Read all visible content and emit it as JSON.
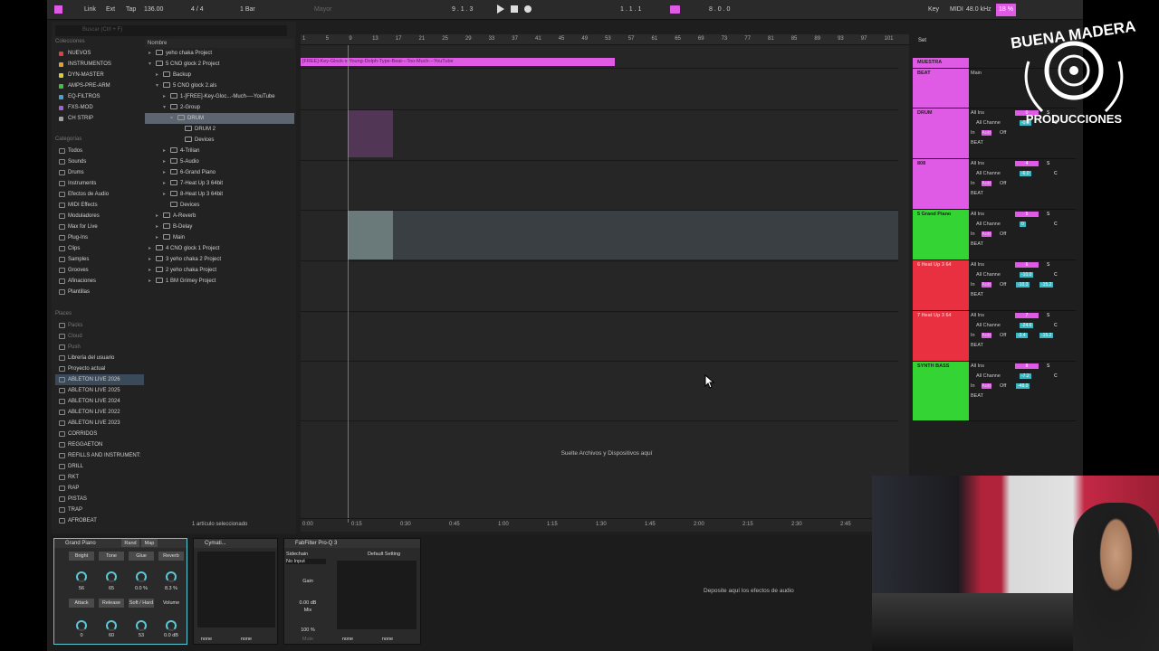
{
  "topbar": {
    "link": "Link",
    "ext": "Ext",
    "tap": "Tap",
    "tempo": "136.00",
    "signature": "4 / 4",
    "quantize": "1 Bar",
    "key_mode": "Mayor",
    "position": "9 .   1 .   3",
    "loop_start": "1 .   1 .   1",
    "loop_length": "8 .   0 .   0",
    "key_label": "Key",
    "midi_label": "MIDI",
    "sample_rate": "48.0 kHz",
    "cpu": "18 %"
  },
  "browser": {
    "search_placeholder": "Buscar (Ctrl + F)",
    "collections_header": "Colecciones",
    "collections": [
      {
        "label": "NUEVOS",
        "color": "#e04040"
      },
      {
        "label": "INSTRUMENTOS",
        "color": "#e0a030"
      },
      {
        "label": "DYN-MASTER",
        "color": "#d0d030"
      },
      {
        "label": "AMPS-PRE-ARM",
        "color": "#40c040"
      },
      {
        "label": "EQ-FILTROS",
        "color": "#40a0e0"
      },
      {
        "label": "FXS-MOD",
        "color": "#a060e0"
      },
      {
        "label": "CH STRIP",
        "color": "#a0a0a0"
      }
    ],
    "categories_header": "Categorías",
    "categories": [
      "Todos",
      "Sounds",
      "Drums",
      "Instruments",
      "Efectos de Audio",
      "MIDI Effects",
      "Moduladores",
      "Max for Live",
      "Plug-Ins",
      "Clips",
      "Samples",
      "Grooves",
      "Afinaciones",
      "Plantillas"
    ],
    "places_header": "Places",
    "places": [
      "Packs",
      "Cloud",
      "Push",
      "Librería del usuario",
      "Proyecto actual",
      "ABLETON LIVE 2026",
      "ABLETON LIVE 2025",
      "ABLETON LIVE 2024",
      "ABLETON LIVE 2022",
      "ABLETON LIVE 2023",
      "CORRIDOS",
      "REGGAETON",
      "REFILLS AND INSTRUMENT:",
      "DRILL",
      "RKT",
      "RAP",
      "PISTAS",
      "TRAP",
      "AFROBEAT"
    ],
    "name_header": "Nombre",
    "tree": [
      {
        "label": "yeho chaka Project",
        "indent": 0,
        "tri": "▸"
      },
      {
        "label": "5 CNO glock 2 Project",
        "indent": 0,
        "tri": "▾"
      },
      {
        "label": "Backup",
        "indent": 1,
        "tri": "▸"
      },
      {
        "label": "5 CNO glock 2.als",
        "indent": 1,
        "tri": "▾"
      },
      {
        "label": "1-[FREE]-Key-Gloc...-Much----YouTube",
        "indent": 2,
        "tri": "▸"
      },
      {
        "label": "2-Group",
        "indent": 2,
        "tri": "▾"
      },
      {
        "label": "DRUM",
        "indent": 3,
        "tri": "▾"
      },
      {
        "label": "DRUM 2",
        "indent": 4,
        "tri": ""
      },
      {
        "label": "Devices",
        "indent": 4,
        "tri": ""
      },
      {
        "label": "4-Trilian",
        "indent": 2,
        "tri": "▸"
      },
      {
        "label": "5-Audio",
        "indent": 2,
        "tri": "▸"
      },
      {
        "label": "6-Grand Piano",
        "indent": 2,
        "tri": "▸"
      },
      {
        "label": "7-Heat Up 3 64bit",
        "indent": 2,
        "tri": "▸"
      },
      {
        "label": "8-Heat Up 3 64bit",
        "indent": 2,
        "tri": "▸"
      },
      {
        "label": "Devices",
        "indent": 2,
        "tri": ""
      },
      {
        "label": "A-Reverb",
        "indent": 1,
        "tri": "▸"
      },
      {
        "label": "B-Delay",
        "indent": 1,
        "tri": "▸"
      },
      {
        "label": "Main",
        "indent": 1,
        "tri": "▸"
      },
      {
        "label": "4 CNO glock 1 Project",
        "indent": 0,
        "tri": "▸"
      },
      {
        "label": "3 yeho chaka 2 Project",
        "indent": 0,
        "tri": "▸"
      },
      {
        "label": "2 yeho chaka Project",
        "indent": 0,
        "tri": "▸"
      },
      {
        "label": "1 BM Grimey Project",
        "indent": 0,
        "tri": "▸"
      }
    ],
    "status": "1 artículo seleccionado"
  },
  "arrangement": {
    "bars": [
      "1",
      "5",
      "9",
      "13",
      "17",
      "21",
      "25",
      "29",
      "33",
      "37",
      "41",
      "45",
      "49",
      "53",
      "57",
      "61",
      "65",
      "69",
      "73",
      "77",
      "81",
      "85",
      "89",
      "93",
      "97",
      "101"
    ],
    "times": [
      "0:00",
      "0:15",
      "0:30",
      "0:45",
      "1:00",
      "1:15",
      "1:30",
      "1:45",
      "2:00",
      "2:15",
      "2:30",
      "2:45"
    ],
    "top_clip": "[FREE]-Key-Glock-x-Young-Dolph-Type-Beat---Too-Much---YouTube",
    "drop_text": "Suelte Archivos y Dispositivos aquí"
  },
  "tracks": [
    {
      "name": "MUESTRA",
      "color": "#e05be5",
      "in": "",
      "sub": ""
    },
    {
      "name": "BEAT",
      "color": "#e05be5",
      "in": "Main",
      "sub": ""
    },
    {
      "name": "DRUM",
      "color": "#e05be5",
      "in": "All Ins",
      "sub": "All Channe",
      "out": "BEAT",
      "vol": "0",
      "pan": "-0.0"
    },
    {
      "name": "808",
      "color": "#e05be5",
      "in": "All Ins",
      "sub": "All Channe",
      "out": "BEAT",
      "vol": "4",
      "pan": "-6.0"
    },
    {
      "name": "5 Grand Piano",
      "color": "#35d435",
      "in": "All Ins",
      "sub": "All Channe",
      "out": "BEAT",
      "vol": "5",
      "pan": "0"
    },
    {
      "name": "6 Heat Up 3 64",
      "color": "#e83040",
      "in": "All Ins",
      "sub": "All Channe",
      "out": "BEAT",
      "vol": "6",
      "pan": "-10.0",
      "extra": "-10.3",
      "extra2": "-15.2"
    },
    {
      "name": "7 Heat Up 3 64",
      "color": "#e83040",
      "in": "All Ins",
      "sub": "All Channe",
      "out": "BEAT",
      "vol": "7",
      "pan": "-24.6",
      "extra": "-3.4",
      "extra2": "-15.2"
    },
    {
      "name": "SYNTH BASS",
      "color": "#35d435",
      "in": "All Ins",
      "sub": "All Channe",
      "out": "BEAT",
      "vol": "8",
      "pan": "-7.2",
      "extra": "-48.0"
    }
  ],
  "track_labels": {
    "in": "In",
    "auto": "Auto",
    "off": "Off",
    "set": "Set",
    "s": "S",
    "c": "C"
  },
  "devices": {
    "grand_piano": {
      "title": "Grand Piano",
      "rand": "Rand",
      "map": "Map",
      "params1": [
        "Bright",
        "Tone",
        "Glue",
        "Reverb"
      ],
      "values1": [
        "56",
        "65",
        "0.0 %",
        "8.3 %"
      ],
      "params2": [
        "Attack",
        "Release",
        "Soft / Hard",
        "Volume"
      ],
      "values2": [
        "0",
        "60",
        "53",
        "0.0 dB"
      ]
    },
    "cymatics": {
      "title": "Cymati...",
      "out1": "none",
      "out2": "none"
    },
    "fabfilter": {
      "title": "FabFilter Pro-Q 3",
      "sidechain": "Sidechain",
      "input": "No Input",
      "gain": "Gain",
      "gain_val": "0.00 dB",
      "mix": "Mix",
      "mix_val": "100 %",
      "mute": "Mute",
      "preset": "Default Setting",
      "out1": "none",
      "out2": "none"
    },
    "drop_fx": "Deposite aquí los efectos de audio"
  },
  "logo": {
    "line1": "BUENA MADERA",
    "line2": "PRODUCCIONES"
  }
}
